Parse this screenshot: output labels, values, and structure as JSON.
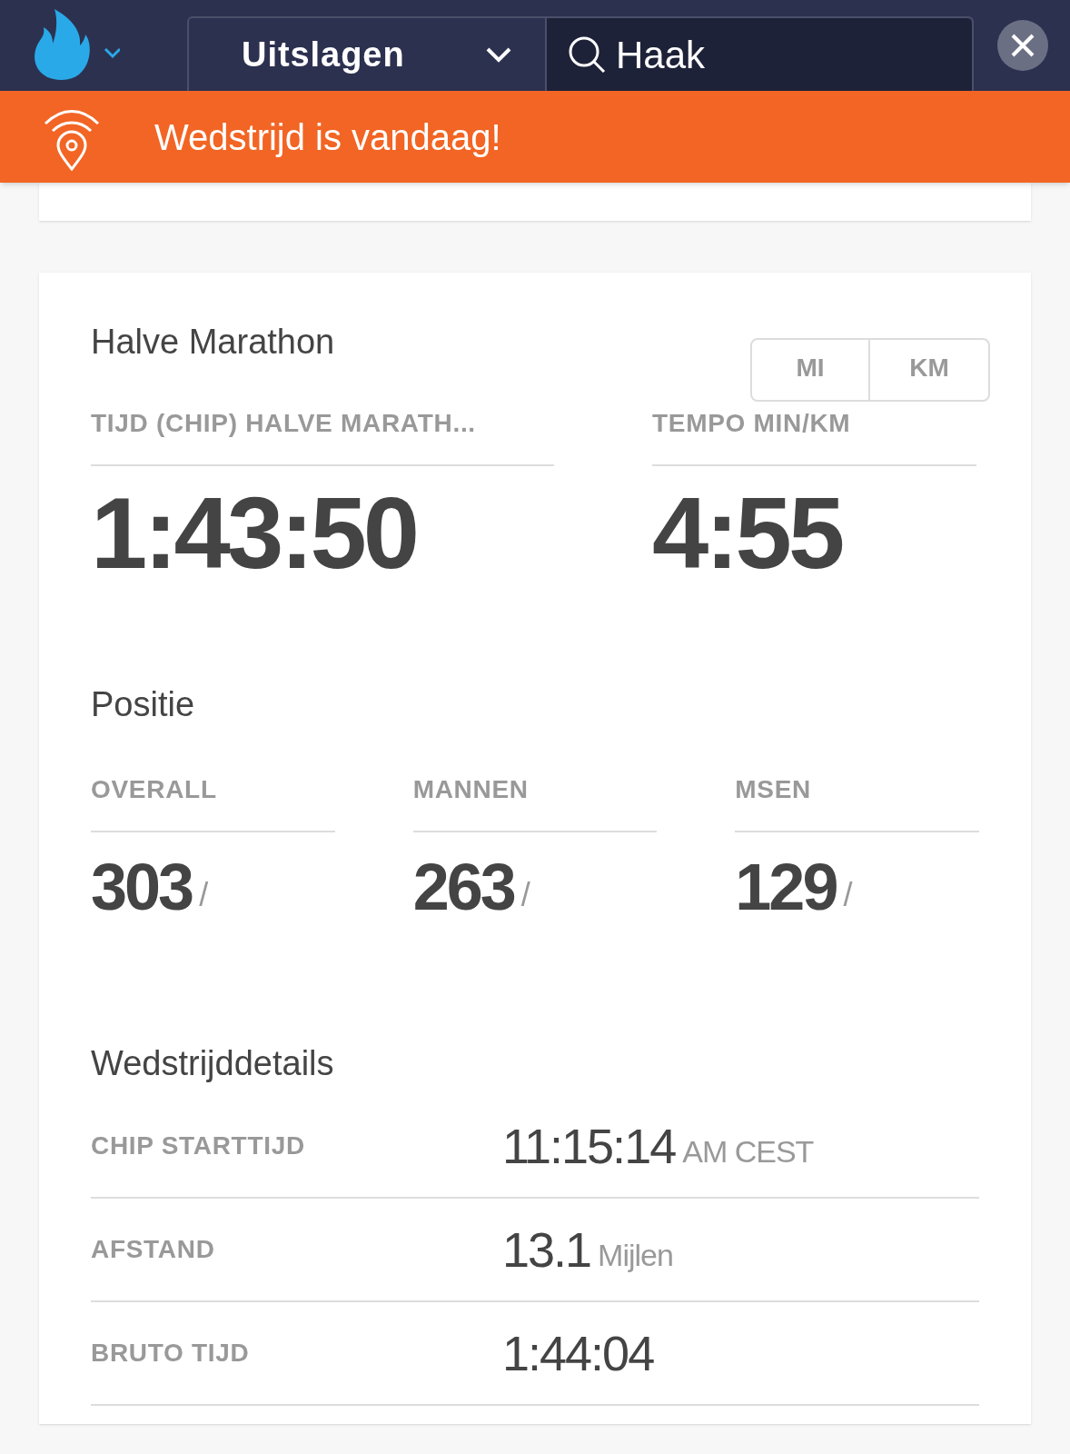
{
  "header": {
    "section_select": "Uitslagen",
    "search_value": "Haak"
  },
  "banner": {
    "text": "Wedstrijd is vandaag!"
  },
  "result": {
    "title": "Halve Marathon",
    "stats": [
      {
        "label": "TIJD (CHIP) HALVE MARATH...",
        "value": "1:43:50"
      },
      {
        "label": "TEMPO MIN/KM",
        "value": "4:55"
      }
    ],
    "unit_toggle": [
      "MI",
      "KM"
    ]
  },
  "position": {
    "title": "Positie",
    "ranks": [
      {
        "label": "OVERALL",
        "value": "303",
        "separator": "/"
      },
      {
        "label": "MANNEN",
        "value": "263",
        "separator": "/"
      },
      {
        "label": "MSEN",
        "value": "129",
        "separator": "/"
      }
    ]
  },
  "details": {
    "title": "Wedstrijddetails",
    "rows": [
      {
        "label": "CHIP STARTTIJD",
        "value": "11:15:14",
        "unit": "AM CEST"
      },
      {
        "label": "AFSTAND",
        "value": "13.1",
        "unit": "Mijlen"
      },
      {
        "label": "BRUTO TIJD",
        "value": "1:44:04"
      }
    ]
  }
}
